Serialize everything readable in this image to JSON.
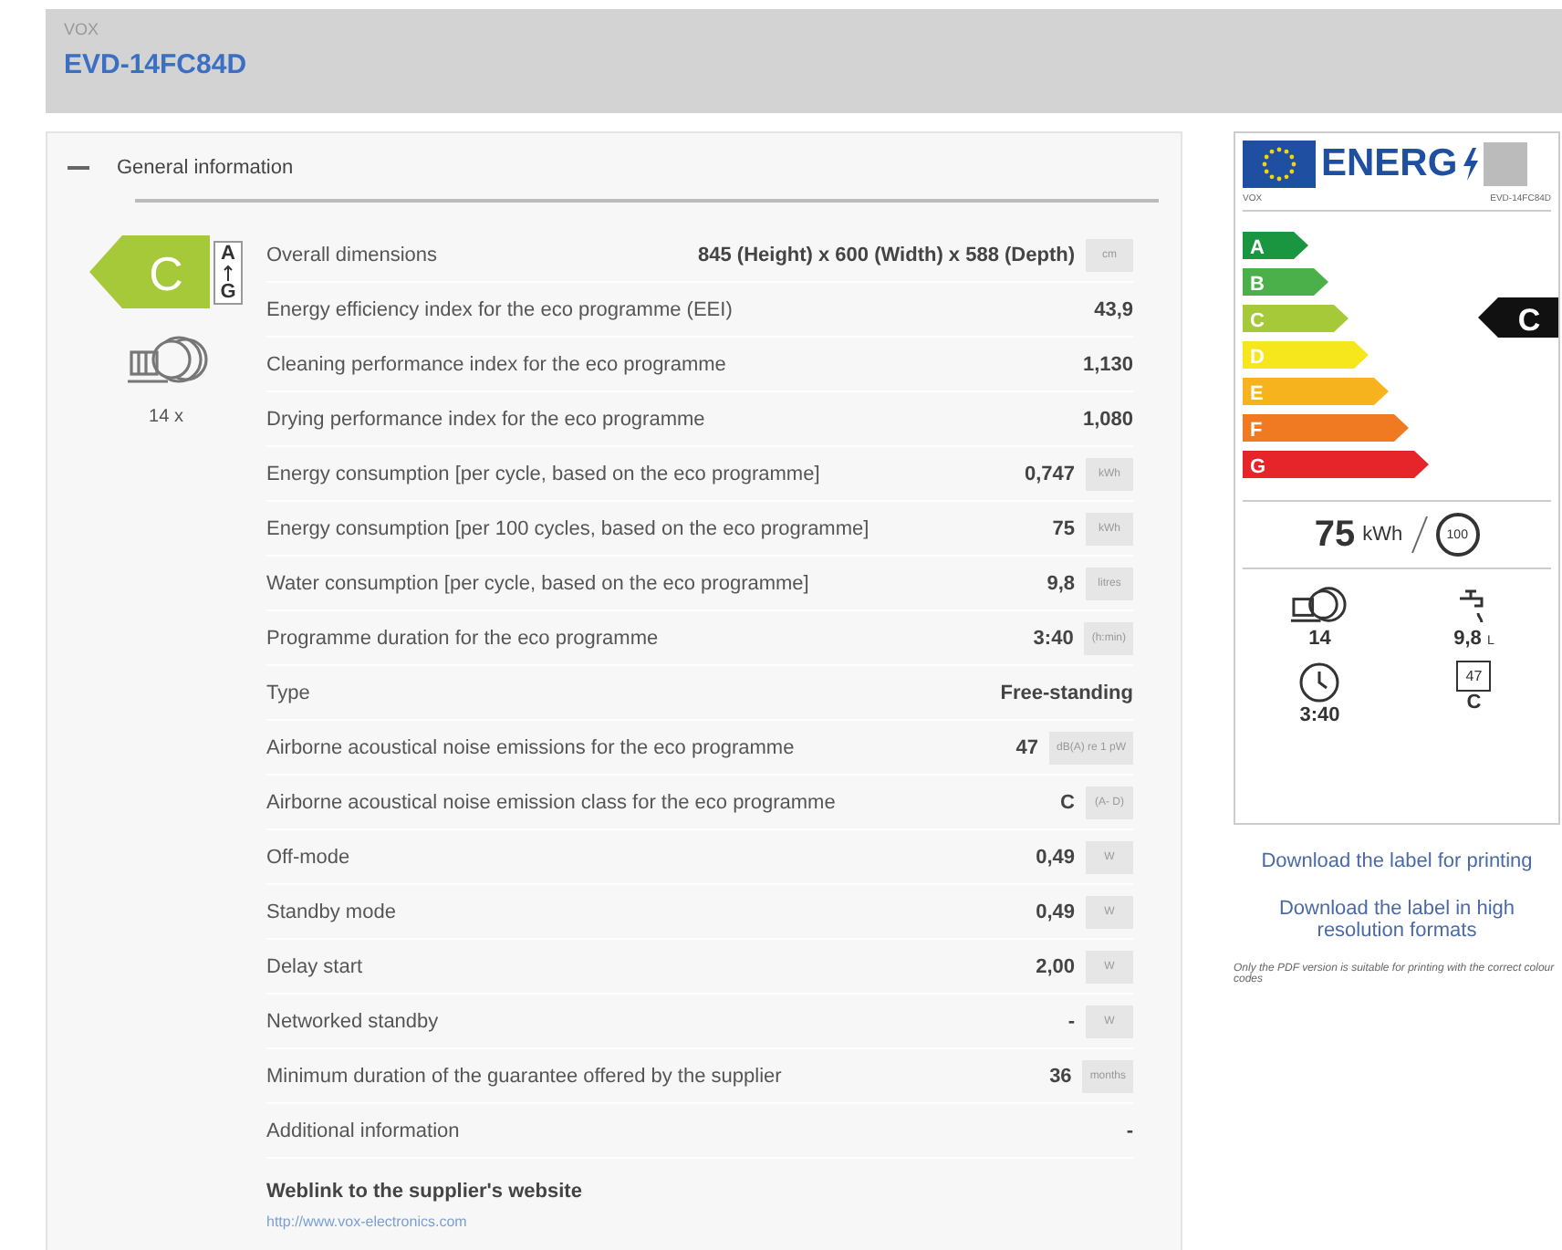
{
  "header": {
    "supplier": "VOX",
    "model": "EVD-14FC84D"
  },
  "section": {
    "title": "General information",
    "expanded": true,
    "class_badge": {
      "rating": "C",
      "top": "A",
      "bottom": "G"
    },
    "capacity": "14 x",
    "rows": [
      {
        "label": "Overall dimensions",
        "value": "845 (Height) x 600 (Width) x 588 (Depth)",
        "unit": "cm"
      },
      {
        "label": "Energy efficiency index for the eco programme (EEI)",
        "value": "43,9"
      },
      {
        "label": "Cleaning performance index for the eco programme",
        "value": "1,130"
      },
      {
        "label": "Drying performance index for the eco programme",
        "value": "1,080"
      },
      {
        "label": "Energy consumption [per cycle, based on the eco programme]",
        "value": "0,747",
        "unit": "kWh"
      },
      {
        "label": "Energy consumption [per 100 cycles, based on the eco programme]",
        "value": "75",
        "unit": "kWh"
      },
      {
        "label": "Water consumption [per cycle, based on the eco programme]",
        "value": "9,8",
        "unit": "litres"
      },
      {
        "label": "Programme duration for the eco programme",
        "value": "3:40",
        "unit": "(h:min)"
      },
      {
        "label": "Type",
        "value": "Free-standing"
      },
      {
        "label": "Airborne acoustical noise emissions for the eco programme",
        "value": "47",
        "unit": "dB(A) re 1 pW"
      },
      {
        "label": "Airborne acoustical noise emission class for the eco programme",
        "value": "C",
        "unit": "(A- D)"
      },
      {
        "label": "Off-mode",
        "value": "0,49",
        "unit": "W"
      },
      {
        "label": "Standby mode",
        "value": "0,49",
        "unit": "W"
      },
      {
        "label": "Delay start",
        "value": "2,00",
        "unit": "W"
      },
      {
        "label": "Networked standby",
        "value": "-",
        "unit": "W"
      },
      {
        "label": "Minimum duration of the guarantee offered by the supplier",
        "value": "36",
        "unit": "months"
      },
      {
        "label": "Additional information",
        "value": "-"
      }
    ],
    "weblink": {
      "title": "Weblink to the supplier's website",
      "url": "http://www.vox-electronics.com"
    }
  },
  "label": {
    "logo": "ENERG",
    "supplier": "VOX",
    "model": "EVD-14FC84D",
    "rating": "C",
    "classes": [
      {
        "letter": "A",
        "color": "#1a9641",
        "selected": false
      },
      {
        "letter": "B",
        "color": "#4bb04a",
        "selected": false
      },
      {
        "letter": "C",
        "color": "#a6c93a",
        "selected": true
      },
      {
        "letter": "D",
        "color": "#f5e71c",
        "selected": false
      },
      {
        "letter": "E",
        "color": "#f7b31e",
        "selected": false
      },
      {
        "letter": "F",
        "color": "#ef7a22",
        "selected": false
      },
      {
        "letter": "G",
        "color": "#e5252a",
        "selected": false
      }
    ],
    "energy": "75",
    "energy_unit": "kWh",
    "cycles": "100",
    "capacity": "14",
    "water": "9,8",
    "water_unit": "L",
    "duration": "3:40",
    "noise": "47",
    "noise_class": "C"
  },
  "links": [
    "Download the label for printing",
    "Download the label in high resolution formats"
  ],
  "note": "Only the PDF version is suitable for printing with the correct colour codes"
}
